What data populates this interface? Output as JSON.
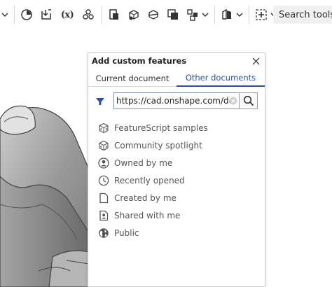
{
  "toolbar": {
    "fx_label": "(x)",
    "search_label": "Search tools..."
  },
  "dialog": {
    "title": "Add custom features",
    "tabs": [
      {
        "label": "Current document",
        "active": false
      },
      {
        "label": "Other documents",
        "active": true
      }
    ],
    "url_value": "https://cad.onshape.com/docur",
    "accent_color": "#2c4f9e",
    "items": [
      {
        "label": "FeatureScript samples",
        "icon": "featurescript-icon"
      },
      {
        "label": "Community spotlight",
        "icon": "featurescript-icon"
      },
      {
        "label": "Owned by me",
        "icon": "user-icon"
      },
      {
        "label": "Recently opened",
        "icon": "clock-icon"
      },
      {
        "label": "Created by me",
        "icon": "document-icon"
      },
      {
        "label": "Shared with me",
        "icon": "shared-icon"
      },
      {
        "label": "Public",
        "icon": "globe-icon"
      }
    ]
  }
}
